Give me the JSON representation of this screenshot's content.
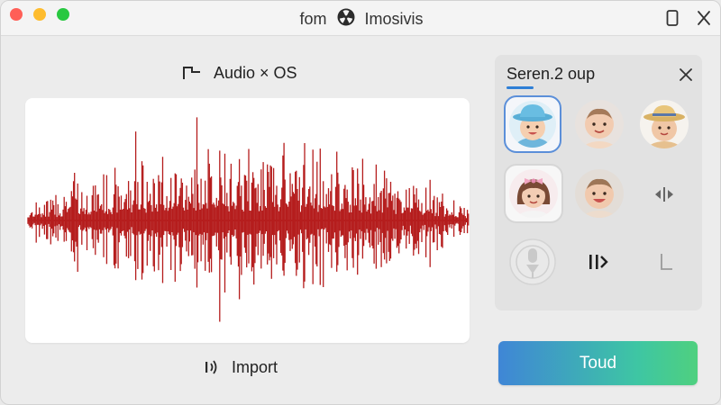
{
  "window": {
    "title_left": "fom",
    "title_right": "Imosivis",
    "controls": [
      "tablet-icon",
      "close-icon"
    ]
  },
  "audio": {
    "title": "Audio × OS",
    "title_icon": "step-icon",
    "waveform_color": "#b51d1d",
    "import_label": "Import",
    "import_icon": "audio-waves-icon"
  },
  "panel": {
    "title": "Seren.2 oup",
    "accent": "#2f7fd6",
    "avatars": [
      {
        "name": "baby-blue-hat",
        "selected": true
      },
      {
        "name": "baby-plain",
        "selected": false
      },
      {
        "name": "baby-straw-hat",
        "selected": false
      },
      {
        "name": "baby-bow",
        "selected": true
      },
      {
        "name": "baby-smiling",
        "selected": false
      }
    ],
    "controls": [
      "split-arrows-icon",
      "mic-disabled-icon",
      "bar-arrow-icon",
      "corner-icon"
    ]
  },
  "action": {
    "label": "Toud"
  }
}
